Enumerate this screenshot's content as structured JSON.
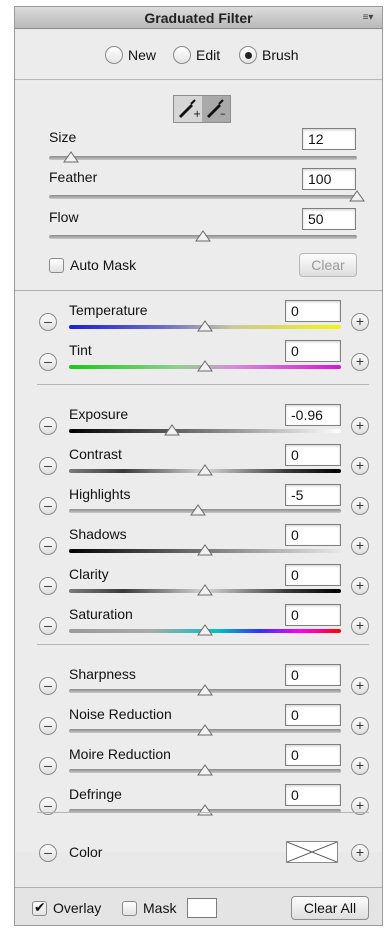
{
  "panel": {
    "title": "Graduated Filter"
  },
  "mode": {
    "options": [
      {
        "label": "New",
        "selected": false
      },
      {
        "label": "Edit",
        "selected": false
      },
      {
        "label": "Brush",
        "selected": true
      }
    ]
  },
  "brush": {
    "add_icon": "brush-add-icon",
    "erase_icon": "brush-erase-icon",
    "size": {
      "label": "Size",
      "value": "12",
      "position": 0.07
    },
    "feather": {
      "label": "Feather",
      "value": "100",
      "position": 1.0
    },
    "flow": {
      "label": "Flow",
      "value": "50",
      "position": 0.5
    },
    "auto_mask": {
      "label": "Auto Mask",
      "checked": false
    },
    "clear_label": "Clear"
  },
  "adjustments": [
    {
      "label": "Temperature",
      "value": "0",
      "position": 0.5,
      "track": "temperature"
    },
    {
      "label": "Tint",
      "value": "0",
      "position": 0.5,
      "track": "tint"
    },
    {
      "label": "Exposure",
      "value": "-0.96",
      "position": 0.38,
      "track": "exposure"
    },
    {
      "label": "Contrast",
      "value": "0",
      "position": 0.5,
      "track": "contrast"
    },
    {
      "label": "Highlights",
      "value": "-5",
      "position": 0.475,
      "track": "gray"
    },
    {
      "label": "Shadows",
      "value": "0",
      "position": 0.5,
      "track": "shadows"
    },
    {
      "label": "Clarity",
      "value": "0",
      "position": 0.5,
      "track": "contrast"
    },
    {
      "label": "Saturation",
      "value": "0",
      "position": 0.5,
      "track": "saturation"
    },
    {
      "label": "Sharpness",
      "value": "0",
      "position": 0.5,
      "track": "gray"
    },
    {
      "label": "Noise Reduction",
      "value": "0",
      "position": 0.5,
      "track": "gray"
    },
    {
      "label": "Moire Reduction",
      "value": "0",
      "position": 0.5,
      "track": "gray"
    },
    {
      "label": "Defringe",
      "value": "0",
      "position": 0.5,
      "track": "gray"
    }
  ],
  "color": {
    "label": "Color"
  },
  "footer": {
    "overlay": {
      "label": "Overlay",
      "checked": true
    },
    "mask": {
      "label": "Mask",
      "checked": false
    },
    "clear_all_label": "Clear All"
  }
}
